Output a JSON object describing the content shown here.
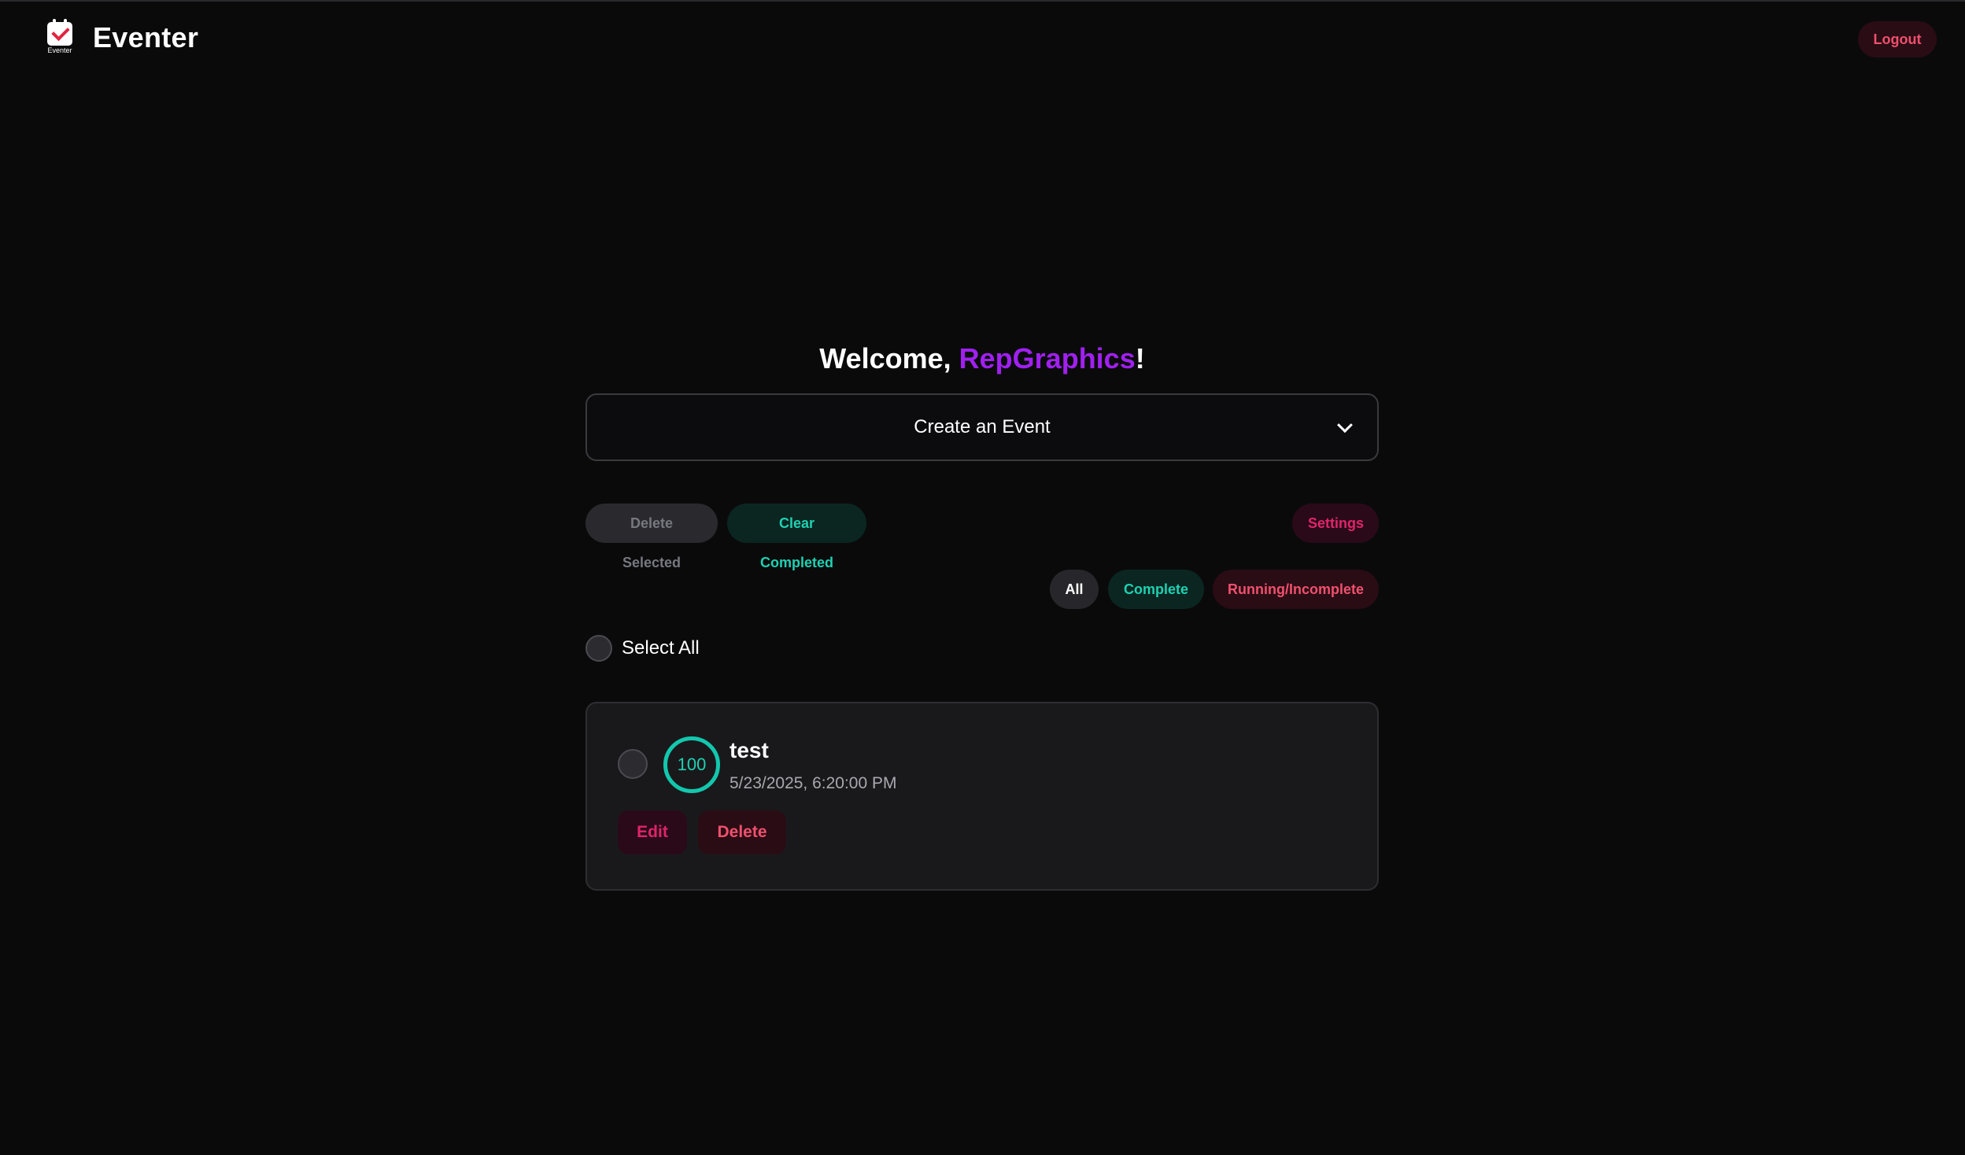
{
  "header": {
    "brand_name": "Eventer",
    "logo_caption": "Eventer",
    "logout_label": "Logout"
  },
  "welcome": {
    "prefix": "Welcome, ",
    "username": "RepGraphics",
    "suffix": "!"
  },
  "create_event": {
    "label": "Create an Event"
  },
  "actions": {
    "delete_selected": "Delete Selected",
    "clear_completed": "Clear Completed",
    "settings": "Settings"
  },
  "filters": {
    "all": "All",
    "complete": "Complete",
    "running": "Running/Incomplete"
  },
  "select_all_label": "Select All",
  "events": [
    {
      "progress": "100",
      "title": "test",
      "datetime": "5/23/2025, 6:20:00 PM",
      "edit_label": "Edit",
      "delete_label": "Delete"
    }
  ],
  "colors": {
    "background": "#0a0a0b",
    "accent_purple": "#a020f0",
    "teal": "#1fd1b2",
    "pink": "#e0246a",
    "red": "#f0506e"
  }
}
